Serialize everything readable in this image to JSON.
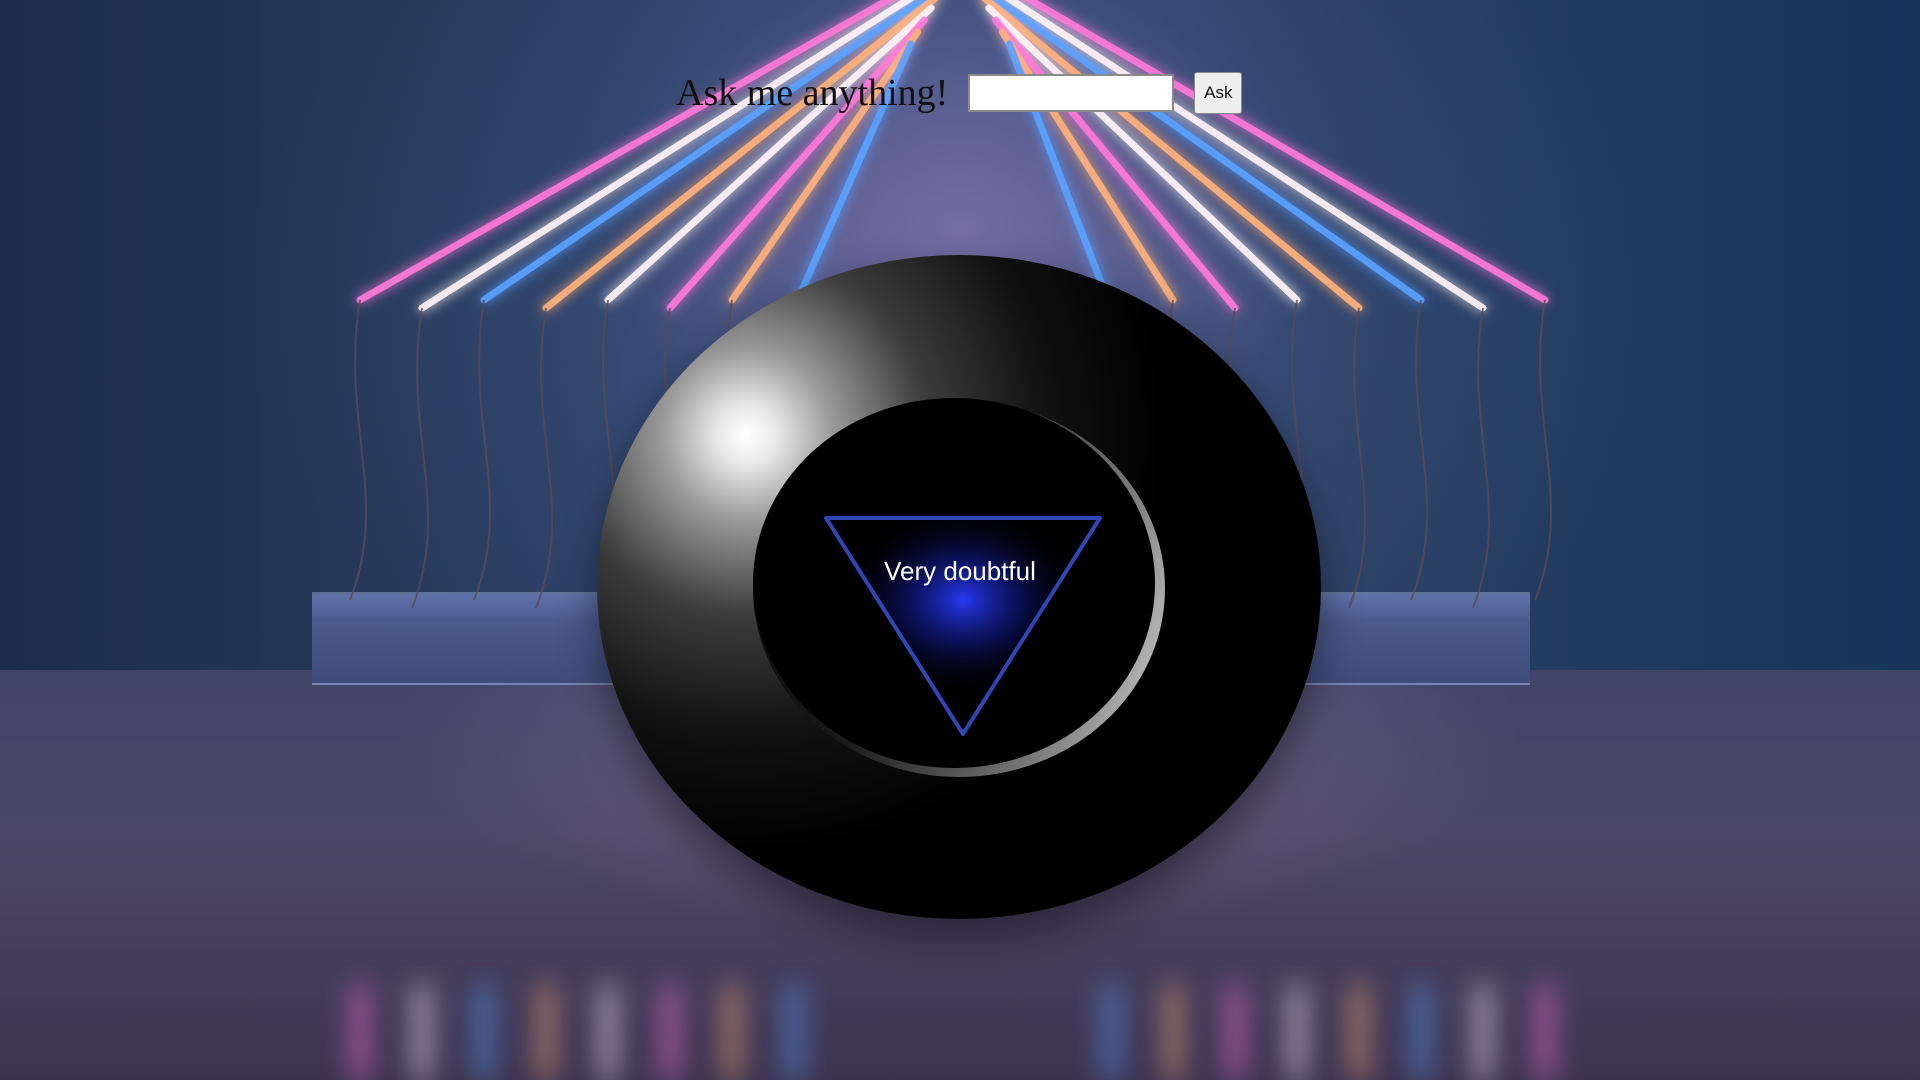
{
  "form": {
    "label": "Ask me anything!",
    "input_value": "",
    "input_placeholder": "",
    "button_label": "Ask"
  },
  "ball": {
    "answer": "Very doubtful",
    "triangle_color": "#2f46b4",
    "glow_color": "#1e35d8"
  },
  "colors": {
    "neon_pink": "#ff7ad9",
    "neon_orange": "#ffb27a",
    "neon_blue": "#5aa2ff",
    "neon_white": "#fff4f8"
  },
  "icons": {
    "triangle": "triangle-icon"
  }
}
